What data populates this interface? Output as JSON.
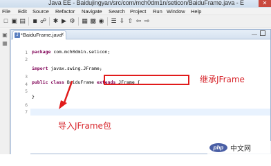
{
  "window": {
    "title": "Java EE - Baidujingyan/src/com/mch0dm1n/seticon/BaiduFrame.java - E",
    "close_glyph": "✕"
  },
  "menu": [
    "File",
    "Edit",
    "Source",
    "Refactor",
    "Navigate",
    "Search",
    "Project",
    "Run",
    "Window",
    "Help"
  ],
  "editor_tab": {
    "label": "*BaiduFrame.java",
    "close_glyph": "✕",
    "icon": "java-file-icon"
  },
  "gutter_lines": [
    "1",
    "2",
    "3",
    "4",
    "5",
    "6",
    "7"
  ],
  "code": {
    "line1_kw": "package",
    "line1_rest": " com.mch0dm1n.seticon;",
    "line3_kw": "import",
    "line3_rest": " javax.swing.JFrame;",
    "line5_kw1": "public class",
    "line5_mid": " BaiduFrame ",
    "line5_kw2": "extends",
    "line5_rest": " JFrame {",
    "line7": "}"
  },
  "annotations": {
    "inherit": "继承JFrame",
    "import": "导入JFrame包",
    "color": "#d7262c"
  },
  "watermark": {
    "logo": "php",
    "text": "中文网"
  }
}
